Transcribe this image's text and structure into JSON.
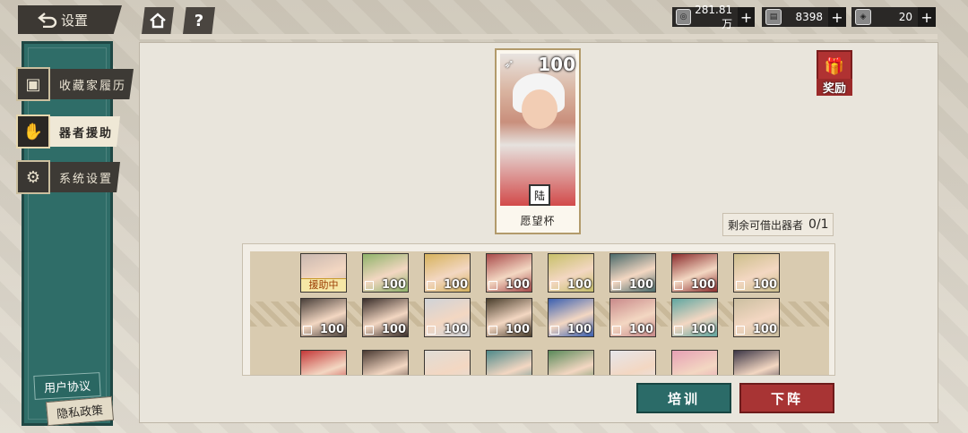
{
  "header": {
    "back_label": "设置",
    "home_icon": "home-icon",
    "help_label": "?"
  },
  "resources": [
    {
      "name": "coin",
      "value": "281.81万"
    },
    {
      "name": "ticket",
      "value": "8398"
    },
    {
      "name": "gem",
      "value": "20"
    }
  ],
  "sidebar": {
    "items": [
      {
        "label": "收藏家履历",
        "active": false
      },
      {
        "label": "器者援助",
        "active": true
      },
      {
        "label": "系统设置",
        "active": false
      }
    ],
    "user_agreement": "用户协议",
    "privacy_policy": "隐私政策"
  },
  "featured": {
    "level": "100",
    "badge": "陆",
    "name": "愿望杯"
  },
  "reward_label": "奖励",
  "remaining": {
    "label": "剩余可借出器者",
    "value": "0/1"
  },
  "roster": {
    "supporting_label": "援助中",
    "rows": [
      [
        {
          "lv": "",
          "supporting": true,
          "color": "#c9b8b0"
        },
        {
          "lv": "100",
          "color": "#8fb36a"
        },
        {
          "lv": "100",
          "color": "#d6b25c"
        },
        {
          "lv": "100",
          "color": "#a94a4a"
        },
        {
          "lv": "100",
          "color": "#c7c06a"
        },
        {
          "lv": "100",
          "color": "#4a6a6a"
        },
        {
          "lv": "100",
          "color": "#8b2c2c"
        },
        {
          "lv": "100",
          "color": "#cdbf8c"
        }
      ],
      [
        {
          "lv": "100",
          "color": "#4a403a"
        },
        {
          "lv": "100",
          "color": "#3a2e2a"
        },
        {
          "lv": "100",
          "color": "#cfd3d8"
        },
        {
          "lv": "100",
          "color": "#4a3e2c"
        },
        {
          "lv": "100",
          "color": "#3a5fb0"
        },
        {
          "lv": "100",
          "color": "#c98a8a"
        },
        {
          "lv": "100",
          "color": "#5fa6a0"
        },
        {
          "lv": "100",
          "color": "#cbbfa0"
        }
      ],
      [
        {
          "lv": "",
          "color": "#c43838"
        },
        {
          "lv": "",
          "color": "#4a3a32"
        },
        {
          "lv": "",
          "color": "#e0ddd6"
        },
        {
          "lv": "",
          "color": "#4f8a8a"
        },
        {
          "lv": "",
          "color": "#5a8a5a"
        },
        {
          "lv": "",
          "color": "#e6e6ea"
        },
        {
          "lv": "",
          "color": "#e6a0b4"
        },
        {
          "lv": "",
          "color": "#3c3646"
        }
      ]
    ]
  },
  "buttons": {
    "train": "培训",
    "withdraw": "下阵"
  },
  "colors": {
    "teal": "#2f6d68",
    "red": "#a83434",
    "gold": "#f6e7a6"
  }
}
